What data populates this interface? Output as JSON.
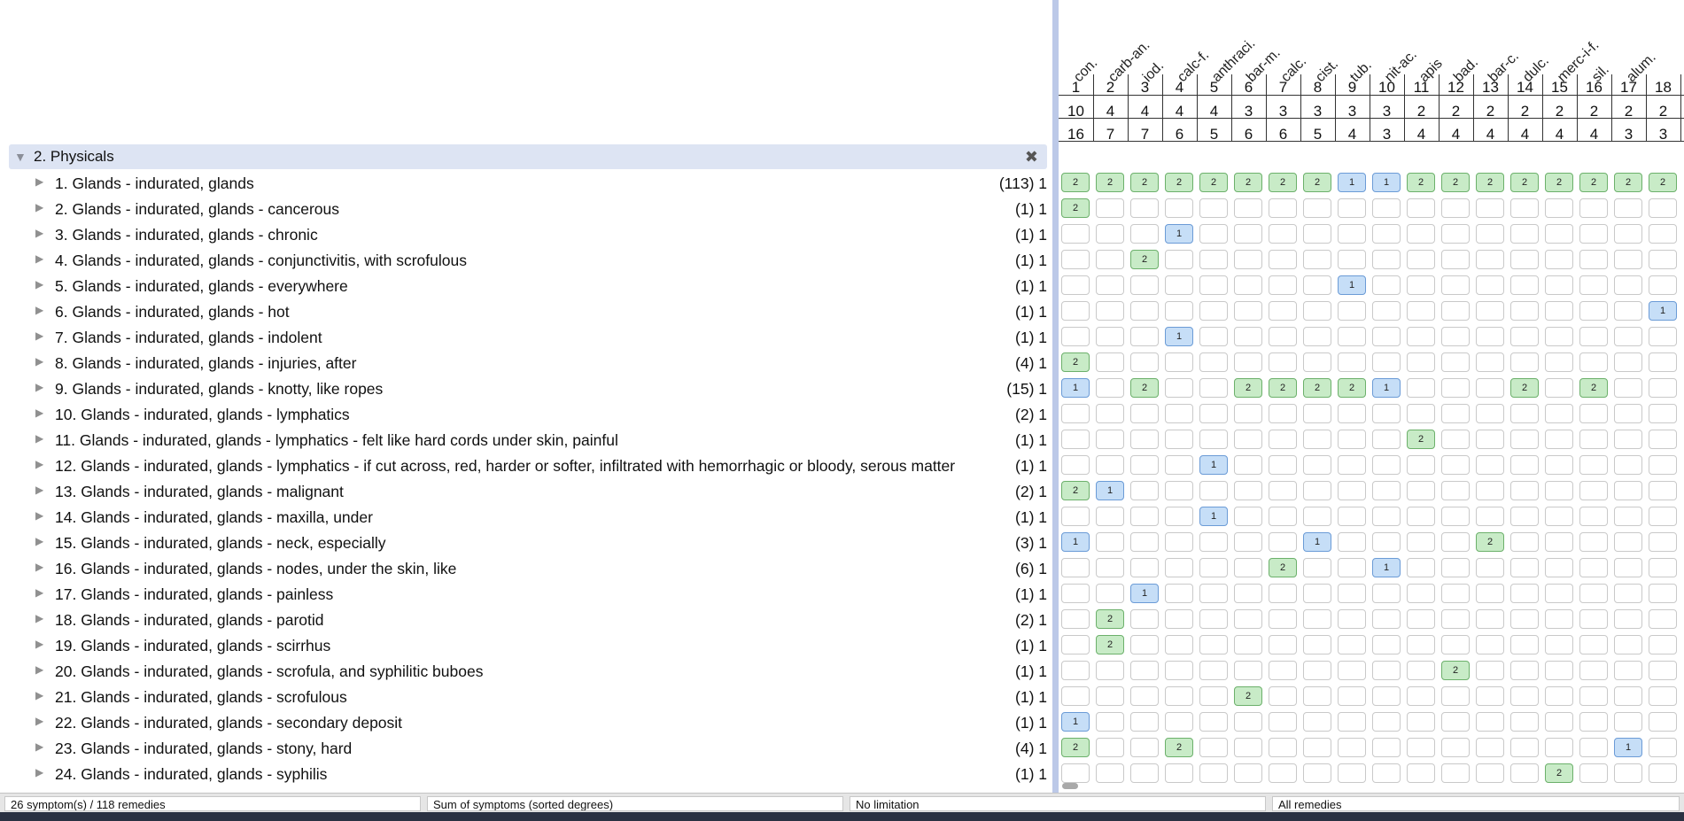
{
  "group": {
    "title": "2. Physicals",
    "close_icon": "close-icon"
  },
  "rubrics": [
    {
      "label": "1. Glands - indurated, glands",
      "count": "(113) 1"
    },
    {
      "label": "2. Glands - indurated, glands - cancerous",
      "count": "(1) 1"
    },
    {
      "label": "3. Glands - indurated, glands - chronic",
      "count": "(1) 1"
    },
    {
      "label": "4. Glands - indurated, glands - conjunctivitis, with scrofulous",
      "count": "(1) 1"
    },
    {
      "label": "5. Glands - indurated, glands - everywhere",
      "count": "(1) 1"
    },
    {
      "label": "6. Glands - indurated, glands - hot",
      "count": "(1) 1"
    },
    {
      "label": "7. Glands - indurated, glands - indolent",
      "count": "(1) 1"
    },
    {
      "label": "8. Glands - indurated, glands - injuries, after",
      "count": "(4) 1"
    },
    {
      "label": "9. Glands - indurated, glands - knotty, like ropes",
      "count": "(15) 1"
    },
    {
      "label": "10. Glands - indurated, glands - lymphatics",
      "count": "(2) 1"
    },
    {
      "label": "11. Glands - indurated, glands - lymphatics - felt like hard cords under skin, painful",
      "count": "(1) 1"
    },
    {
      "label": "12. Glands - indurated, glands - lymphatics - if cut across, red, harder or softer, infiltrated with hemorrhagic or bloody, serous matter",
      "count": "(1) 1"
    },
    {
      "label": "13. Glands - indurated, glands - malignant",
      "count": "(2) 1"
    },
    {
      "label": "14. Glands - indurated, glands - maxilla, under",
      "count": "(1) 1"
    },
    {
      "label": "15. Glands - indurated, glands - neck, especially",
      "count": "(3) 1"
    },
    {
      "label": "16. Glands - indurated, glands - nodes, under the skin, like",
      "count": "(6) 1"
    },
    {
      "label": "17. Glands - indurated, glands - painless",
      "count": "(1) 1"
    },
    {
      "label": "18. Glands - indurated, glands - parotid",
      "count": "(2) 1"
    },
    {
      "label": "19. Glands - indurated, glands - scirrhus",
      "count": "(1) 1"
    },
    {
      "label": "20. Glands - indurated, glands - scrofula, and syphilitic buboes",
      "count": "(1) 1"
    },
    {
      "label": "21. Glands - indurated, glands - scrofulous",
      "count": "(1) 1"
    },
    {
      "label": "22. Glands - indurated, glands - secondary deposit",
      "count": "(1) 1"
    },
    {
      "label": "23. Glands - indurated, glands - stony, hard",
      "count": "(4) 1"
    },
    {
      "label": "24. Glands - indurated, glands - syphilis",
      "count": "(1) 1"
    }
  ],
  "remedies": [
    {
      "abbr": "con.",
      "rank": "1",
      "symptoms": "10",
      "degrees": "16"
    },
    {
      "abbr": "carb-an.",
      "rank": "2",
      "symptoms": "4",
      "degrees": "7"
    },
    {
      "abbr": "iod.",
      "rank": "3",
      "symptoms": "4",
      "degrees": "7"
    },
    {
      "abbr": "calc-f.",
      "rank": "4",
      "symptoms": "4",
      "degrees": "6"
    },
    {
      "abbr": "anthraci.",
      "rank": "5",
      "symptoms": "4",
      "degrees": "5"
    },
    {
      "abbr": "bar-m.",
      "rank": "6",
      "symptoms": "3",
      "degrees": "6"
    },
    {
      "abbr": "calc.",
      "rank": "7",
      "symptoms": "3",
      "degrees": "6"
    },
    {
      "abbr": "cist.",
      "rank": "8",
      "symptoms": "3",
      "degrees": "5"
    },
    {
      "abbr": "tub.",
      "rank": "9",
      "symptoms": "3",
      "degrees": "4"
    },
    {
      "abbr": "nit-ac.",
      "rank": "10",
      "symptoms": "3",
      "degrees": "3"
    },
    {
      "abbr": "apis",
      "rank": "11",
      "symptoms": "2",
      "degrees": "4"
    },
    {
      "abbr": "bad.",
      "rank": "12",
      "symptoms": "2",
      "degrees": "4"
    },
    {
      "abbr": "bar-c.",
      "rank": "13",
      "symptoms": "2",
      "degrees": "4"
    },
    {
      "abbr": "dulc.",
      "rank": "14",
      "symptoms": "2",
      "degrees": "4"
    },
    {
      "abbr": "merc-i-f.",
      "rank": "15",
      "symptoms": "2",
      "degrees": "4"
    },
    {
      "abbr": "sil.",
      "rank": "16",
      "symptoms": "2",
      "degrees": "4"
    },
    {
      "abbr": "alum.",
      "rank": "17",
      "symptoms": "2",
      "degrees": "3"
    },
    {
      "abbr": "",
      "rank": "18",
      "symptoms": "2",
      "degrees": "3"
    }
  ],
  "grid": [
    [
      2,
      2,
      2,
      2,
      2,
      2,
      2,
      2,
      1,
      1,
      2,
      2,
      2,
      2,
      2,
      2,
      2,
      2
    ],
    [
      2,
      0,
      0,
      0,
      0,
      0,
      0,
      0,
      0,
      0,
      0,
      0,
      0,
      0,
      0,
      0,
      0,
      0
    ],
    [
      0,
      0,
      0,
      1,
      0,
      0,
      0,
      0,
      0,
      0,
      0,
      0,
      0,
      0,
      0,
      0,
      0,
      0
    ],
    [
      0,
      0,
      2,
      0,
      0,
      0,
      0,
      0,
      0,
      0,
      0,
      0,
      0,
      0,
      0,
      0,
      0,
      0
    ],
    [
      0,
      0,
      0,
      0,
      0,
      0,
      0,
      0,
      1,
      0,
      0,
      0,
      0,
      0,
      0,
      0,
      0,
      0
    ],
    [
      0,
      0,
      0,
      0,
      0,
      0,
      0,
      0,
      0,
      0,
      0,
      0,
      0,
      0,
      0,
      0,
      0,
      1
    ],
    [
      0,
      0,
      0,
      1,
      0,
      0,
      0,
      0,
      0,
      0,
      0,
      0,
      0,
      0,
      0,
      0,
      0,
      0
    ],
    [
      2,
      0,
      0,
      0,
      0,
      0,
      0,
      0,
      0,
      0,
      0,
      0,
      0,
      0,
      0,
      0,
      0,
      0
    ],
    [
      1,
      0,
      2,
      0,
      0,
      2,
      2,
      2,
      2,
      1,
      0,
      0,
      0,
      2,
      0,
      2,
      0,
      0
    ],
    [
      0,
      0,
      0,
      0,
      0,
      0,
      0,
      0,
      0,
      0,
      0,
      0,
      0,
      0,
      0,
      0,
      0,
      0
    ],
    [
      0,
      0,
      0,
      0,
      0,
      0,
      0,
      0,
      0,
      0,
      2,
      0,
      0,
      0,
      0,
      0,
      0,
      0
    ],
    [
      0,
      0,
      0,
      0,
      1,
      0,
      0,
      0,
      0,
      0,
      0,
      0,
      0,
      0,
      0,
      0,
      0,
      0
    ],
    [
      2,
      1,
      0,
      0,
      0,
      0,
      0,
      0,
      0,
      0,
      0,
      0,
      0,
      0,
      0,
      0,
      0,
      0
    ],
    [
      0,
      0,
      0,
      0,
      1,
      0,
      0,
      0,
      0,
      0,
      0,
      0,
      0,
      0,
      0,
      0,
      0,
      0
    ],
    [
      1,
      0,
      0,
      0,
      0,
      0,
      0,
      1,
      0,
      0,
      0,
      0,
      2,
      0,
      0,
      0,
      0,
      0
    ],
    [
      0,
      0,
      0,
      0,
      0,
      0,
      2,
      0,
      0,
      1,
      0,
      0,
      0,
      0,
      0,
      0,
      0,
      0
    ],
    [
      0,
      0,
      1,
      0,
      0,
      0,
      0,
      0,
      0,
      0,
      0,
      0,
      0,
      0,
      0,
      0,
      0,
      0
    ],
    [
      0,
      2,
      0,
      0,
      0,
      0,
      0,
      0,
      0,
      0,
      0,
      0,
      0,
      0,
      0,
      0,
      0,
      0
    ],
    [
      0,
      2,
      0,
      0,
      0,
      0,
      0,
      0,
      0,
      0,
      0,
      0,
      0,
      0,
      0,
      0,
      0,
      0
    ],
    [
      0,
      0,
      0,
      0,
      0,
      0,
      0,
      0,
      0,
      0,
      0,
      2,
      0,
      0,
      0,
      0,
      0,
      0
    ],
    [
      0,
      0,
      0,
      0,
      0,
      2,
      0,
      0,
      0,
      0,
      0,
      0,
      0,
      0,
      0,
      0,
      0,
      0
    ],
    [
      1,
      0,
      0,
      0,
      0,
      0,
      0,
      0,
      0,
      0,
      0,
      0,
      0,
      0,
      0,
      0,
      0,
      0
    ],
    [
      2,
      0,
      0,
      2,
      0,
      0,
      0,
      0,
      0,
      0,
      0,
      0,
      0,
      0,
      0,
      0,
      1,
      0
    ],
    [
      0,
      0,
      0,
      0,
      0,
      0,
      0,
      0,
      0,
      0,
      0,
      0,
      0,
      0,
      2,
      0,
      0,
      0
    ]
  ],
  "colors": {
    "degree_1": "#c6def7",
    "degree_2": "#c8ebc7",
    "header": "#dde4f3"
  },
  "status": {
    "symptoms": "26 symptom(s) / 118 remedies",
    "sort": "Sum of symptoms (sorted degrees)",
    "limitation": "No limitation",
    "remedy_filter": "All remedies"
  }
}
